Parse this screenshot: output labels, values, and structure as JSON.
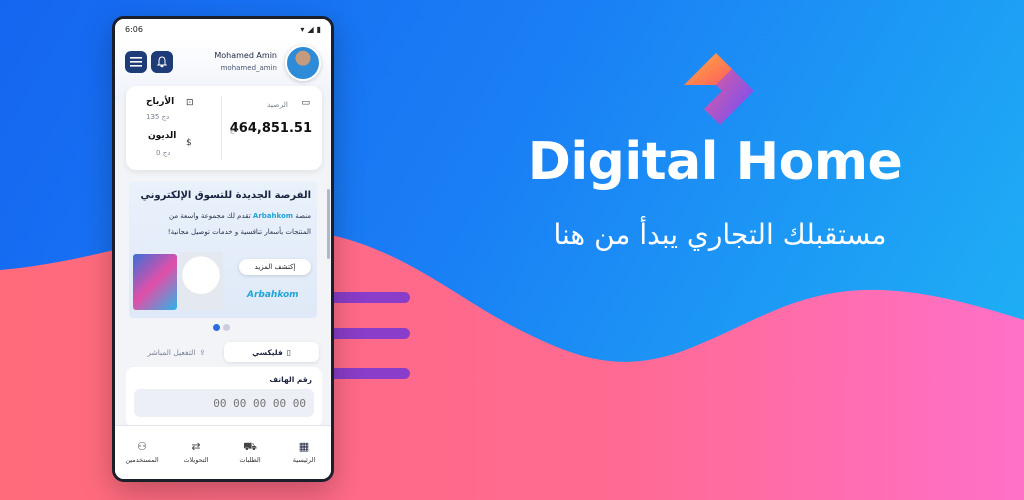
{
  "colors": {
    "bg_start": "#1565f0",
    "bg_end": "#1fb6f5",
    "wave_pink": "#ff6b8b",
    "wave_magenta": "#ff6ec4",
    "dash": "#8a3dc8",
    "accent": "#2b6de0"
  },
  "brand": {
    "title": "Digital Home",
    "tagline": "مستقبلك التجاري يبدأ من هنا",
    "logo_icon": "chevron-logo-icon"
  },
  "phone": {
    "status": {
      "time": "6:06"
    },
    "user": {
      "name": "Mohamed Amin",
      "handle": "mohamed_amin"
    },
    "balance": {
      "label": "الرصيد",
      "amount": "464,851.51",
      "currency": "دج"
    },
    "earnings": {
      "label": "الأرباح",
      "amount": "135 دج"
    },
    "debts": {
      "label": "الديون",
      "amount": "0 دج"
    },
    "banner": {
      "title": "الفرصة الجديدة للتسوق الإلكتروني",
      "line1_prefix": "منصة ",
      "line1_brand": "Arbahkom",
      "line1_suffix": " تقدم لك مجموعة واسعة من",
      "line2": "المنتجات بأسعار تنافسية و خدمات توصيل مجانية!",
      "button": "إكتشف المزيد",
      "logo": "Arbahkom"
    },
    "tabs": [
      {
        "label": "فليكسي"
      },
      {
        "label": "التفعيل المباشر"
      }
    ],
    "phone_field": {
      "label": "رقم الهاتف",
      "placeholder": "00 00 00 00 00"
    },
    "nav": [
      {
        "label": "الرئيسية",
        "icon": "grid-icon"
      },
      {
        "label": "الطلبات",
        "icon": "cart-icon"
      },
      {
        "label": "التحويلات",
        "icon": "transfer-icon"
      },
      {
        "label": "المستخدمين",
        "icon": "user-icon"
      }
    ]
  }
}
